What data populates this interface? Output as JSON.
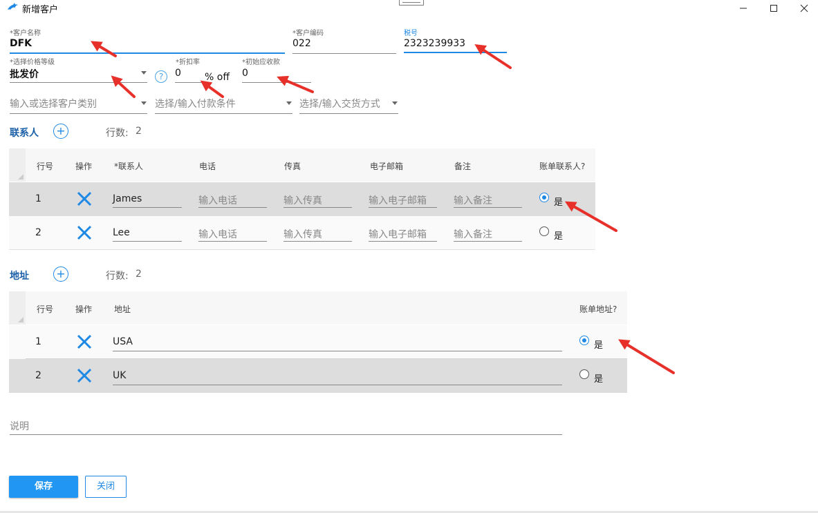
{
  "window": {
    "title": "新增客户",
    "accent": "#1e88e5"
  },
  "form": {
    "customer_name": {
      "label": "*客户名称",
      "value": "DFK"
    },
    "customer_code": {
      "label": "*客户编码",
      "value": "022"
    },
    "tax_id": {
      "label": "税号",
      "value": "2323239933"
    },
    "price_level": {
      "label": "*选择价格等级",
      "value": "批发价"
    },
    "discount": {
      "label": "*折扣率",
      "value": "0",
      "suffix": "% off"
    },
    "initial_receivable": {
      "label": "*初始应收款",
      "value": "0"
    },
    "customer_category": {
      "placeholder": "输入或选择客户类别"
    },
    "payment_terms": {
      "placeholder": "选择/输入付款条件"
    },
    "delivery_method": {
      "placeholder": "选择/输入交货方式"
    },
    "description": {
      "placeholder": "说明"
    }
  },
  "contacts": {
    "title": "联系人",
    "row_count_label": "行数:",
    "row_count": "2",
    "columns": [
      "行号",
      "操作",
      "*联系人",
      "电话",
      "传真",
      "电子邮箱",
      "备注",
      "账单联系人?"
    ],
    "rows": [
      {
        "num": "1",
        "name": "James",
        "phone_ph": "输入电话",
        "fax_ph": "输入传真",
        "email_ph": "输入电子邮箱",
        "note_ph": "输入备注",
        "billing": true,
        "billing_label": "是"
      },
      {
        "num": "2",
        "name": "Lee",
        "phone_ph": "输入电话",
        "fax_ph": "输入传真",
        "email_ph": "输入电子邮箱",
        "note_ph": "输入备注",
        "billing": false,
        "billing_label": "是"
      }
    ]
  },
  "addresses": {
    "title": "地址",
    "row_count_label": "行数:",
    "row_count": "2",
    "columns": [
      "行号",
      "操作",
      "地址",
      "账单地址?"
    ],
    "rows": [
      {
        "num": "1",
        "address": "USA",
        "billing": true,
        "billing_label": "是"
      },
      {
        "num": "2",
        "address": "UK",
        "billing": false,
        "billing_label": "是"
      }
    ]
  },
  "buttons": {
    "save": "保存",
    "close": "关闭"
  },
  "icons": {
    "app": "dolphin-icon",
    "help": "question-icon",
    "help_glyph": "?",
    "add": "plus-circle-icon",
    "add_glyph": "+",
    "delete": "close-x-icon",
    "annotation": "red-arrow-icon"
  }
}
